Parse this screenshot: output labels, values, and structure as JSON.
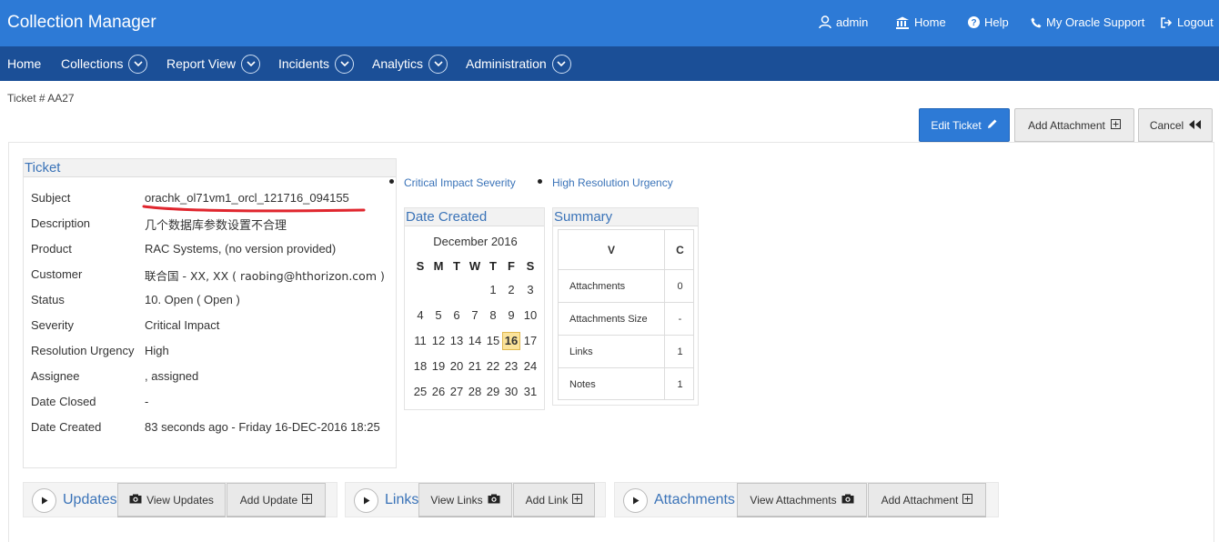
{
  "header": {
    "app_title": "Collection Manager",
    "user": "admin",
    "home": "Home",
    "help": "Help",
    "support": "My Oracle Support",
    "logout": "Logout"
  },
  "nav": {
    "items": [
      {
        "label": "Home"
      },
      {
        "label": "Collections"
      },
      {
        "label": "Report View"
      },
      {
        "label": "Incidents"
      },
      {
        "label": "Analytics"
      },
      {
        "label": "Administration"
      }
    ]
  },
  "crumb": "Ticket # AA27",
  "actions": {
    "edit": "Edit Ticket",
    "add_attachment": "Add Attachment",
    "cancel": "Cancel"
  },
  "ticket": {
    "title": "Ticket",
    "fields": [
      {
        "label": "Subject",
        "value": "orachk_ol71vm1_orcl_121716_094155"
      },
      {
        "label": "Description",
        "value": "几个数据库参数设置不合理"
      },
      {
        "label": "Product",
        "value": "RAC Systems, (no version provided)"
      },
      {
        "label": "Customer",
        "value": "联合国 - XX, XX ( raobing@hthorizon.com )"
      },
      {
        "label": "Status",
        "value": "10. Open ( Open )"
      },
      {
        "label": "Severity",
        "value": "Critical Impact"
      },
      {
        "label": "Resolution Urgency",
        "value": "High"
      },
      {
        "label": "Assignee",
        "value": ", assigned"
      },
      {
        "label": "Date Closed",
        "value": "-"
      },
      {
        "label": "Date Created",
        "value": "83 seconds ago - Friday 16-DEC-2016 18:25"
      }
    ]
  },
  "tags": {
    "severity": "Critical Impact Severity",
    "urgency": "High Resolution Urgency"
  },
  "calendar": {
    "title": "Date Created",
    "month": "December 2016",
    "dow": [
      "S",
      "M",
      "T",
      "W",
      "T",
      "F",
      "S"
    ],
    "weeks": [
      [
        "",
        "",
        "",
        "",
        "1",
        "2",
        "3"
      ],
      [
        "4",
        "5",
        "6",
        "7",
        "8",
        "9",
        "10"
      ],
      [
        "11",
        "12",
        "13",
        "14",
        "15",
        "16",
        "17"
      ],
      [
        "18",
        "19",
        "20",
        "21",
        "22",
        "23",
        "24"
      ],
      [
        "25",
        "26",
        "27",
        "28",
        "29",
        "30",
        "31"
      ]
    ],
    "today": "16"
  },
  "summary": {
    "title": "Summary",
    "col1": "V",
    "col2": "C",
    "rows": [
      {
        "label": "Attachments",
        "value": "0"
      },
      {
        "label": "Attachments Size",
        "value": "-"
      },
      {
        "label": "Links",
        "value": "1"
      },
      {
        "label": "Notes",
        "value": "1"
      }
    ]
  },
  "sections": {
    "updates": {
      "title": "Updates",
      "view": "View Updates",
      "add": "Add Update"
    },
    "links": {
      "title": "Links",
      "view": "View Links",
      "add": "Add Link"
    },
    "attachments": {
      "title": "Attachments",
      "view": "View Attachments",
      "add": "Add Attachment"
    }
  },
  "colors": {
    "header_bg": "#2d7ad6",
    "nav_bg": "#1b4f97",
    "link": "#3a73b8",
    "subject_underline": "#e0262e"
  }
}
